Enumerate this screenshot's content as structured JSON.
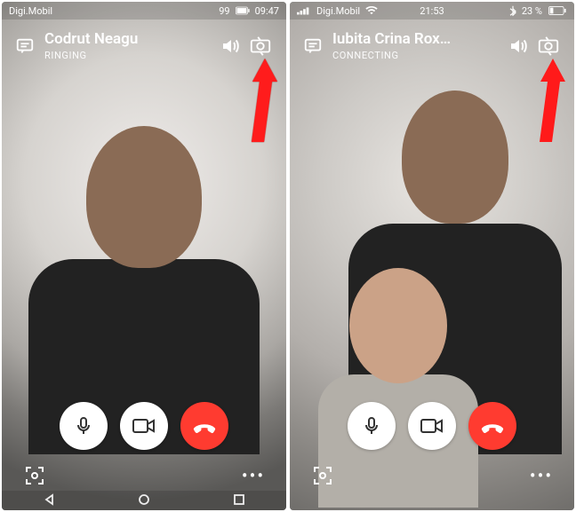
{
  "left": {
    "status": {
      "carrier": "Digi.Mobil",
      "battery_pct": "99",
      "time": "09:47"
    },
    "call": {
      "contact_name": "Codrut Neagu",
      "status": "RINGING"
    }
  },
  "right": {
    "status": {
      "carrier": "Digi.Mobil",
      "time": "21:53",
      "battery_text": "23 %"
    },
    "call": {
      "contact_name": "Iubita Crina Rox…",
      "status": "CONNECTING"
    }
  }
}
